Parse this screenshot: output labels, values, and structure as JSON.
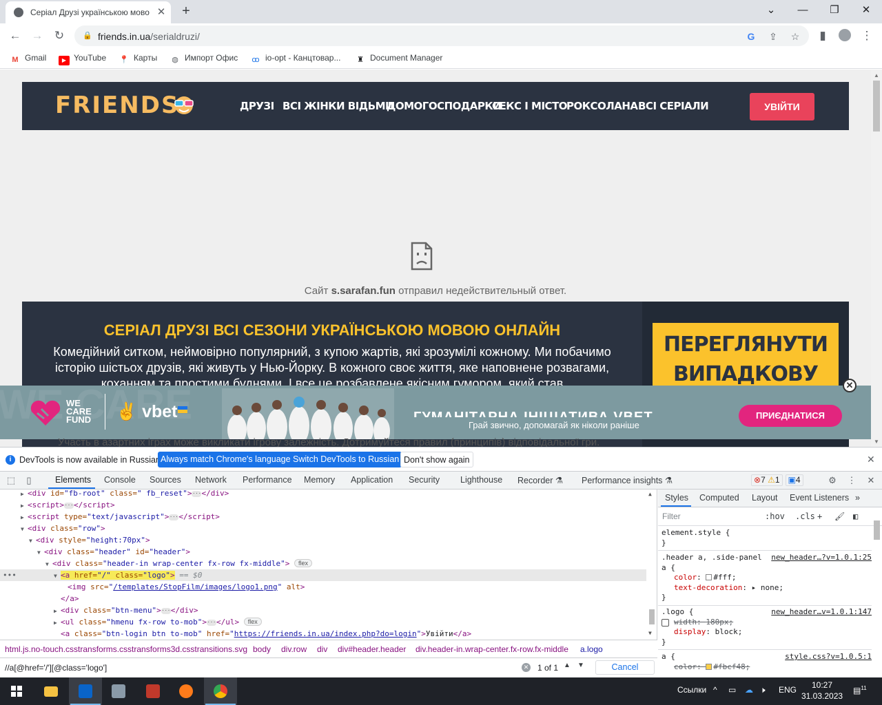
{
  "browser": {
    "tab_title": "Серіал Друзі українською мово",
    "url_host": "friends.in.ua",
    "url_path": "/serialdruzi/",
    "bookmarks": [
      "Gmail",
      "YouTube",
      "Карты",
      "Импорт Офис",
      "io-opt - Канцтовар...",
      "Document Manager"
    ]
  },
  "site": {
    "logo_text": "FRIENDS",
    "nav": [
      "ДРУЗІ",
      "ВСІ ЖІНКИ ВІДЬМИ",
      "ДОМОГОСПОДАРКИ",
      "СЕКС І МІСТО",
      "РОКСОЛАНА",
      "ВСІ СЕРІАЛИ"
    ],
    "login": "УВІЙТИ",
    "error_host": "s.sarafan.fun",
    "error_prefix": "Сайт",
    "error_suffix": "отправил недействительный ответ.",
    "hero_title": "СЕРІАЛ ДРУЗІ ВСІ СЕЗОНИ УКРАЇНСЬКОЮ МОВОЮ ОНЛАЙН",
    "hero_text": "Комедійний ситком, неймовірно популярний, з купою жартів, які зрозумілі кожному. Ми побачимо історію шістьох друзів, які живуть у Нью-Йорку. В кожного своє життя, яке наповнене розвагами, коханням та простими буднями. І все це розбавлене якісним гумором, який став",
    "random_line1": "ПЕРЕГЛЯНУТИ",
    "random_line2": "ВИПАДКОВУ СЕРІЮ",
    "disclaimer": "Участь в азартних іграх може викликати ігрову залежність. Дотримуйтеся правил (принципів) відповідальної гри."
  },
  "ad": {
    "watermark": "WE CARE",
    "wecare": [
      "WE",
      "CARE",
      "FUND"
    ],
    "vbet": "vbet",
    "headline": "ГУМАНІТАРНА ІНІЦІАТИВА VBET",
    "tagline": "Грай звично, допомагай як ніколи раніше",
    "join": "ПРИЄДНАТИСЯ"
  },
  "devtools": {
    "infobar_text": "DevTools is now available in Russian!",
    "infobar_btn1": "Always match Chrome's language",
    "infobar_btn2": "Switch DevTools to Russian",
    "infobar_btn3": "Don't show again",
    "tabs": [
      "Elements",
      "Console",
      "Sources",
      "Network",
      "Performance",
      "Memory",
      "Application",
      "Security",
      "Lighthouse",
      "Recorder",
      "Performance insights"
    ],
    "errors": "7",
    "warnings": "1",
    "messages": "4",
    "dom": {
      "l1_attr_id": "id=",
      "l1_id": "\"fb-root\"",
      "l1_class": "class=",
      "l1_classv": "\" fb_reset\"",
      "l5": "\"row\"",
      "l6_style": "\"height:70px\"",
      "l7_class": "\"header\"",
      "l7_id": "\"header\"",
      "l8_class": "\"header-in wrap-center fx-row fx-middle\"",
      "l9_href": "\"/\"",
      "l9_class": "\"logo\"",
      "l9_eq": "== $0",
      "l10_src": "/templates/StopFilm/images/logo1.png",
      "l12_class": "\"btn-menu\"",
      "l13_class": "\"hmenu fx-row to-mob\"",
      "l14_class": "\"btn-login btn to-mob\"",
      "l14_href": "https://friends.in.ua/index.php?do=login",
      "l14_text": "Увійти",
      "flex": "flex",
      "script_type": "\"text/javascript\""
    },
    "breadcrumbs": [
      "html.js.no-touch.csstransforms.csstransforms3d.csstransitions.svg",
      "body",
      "div.row",
      "div",
      "div#header.header",
      "div.header-in.wrap-center.fx-row.fx-middle",
      "a.logo"
    ],
    "search_value": "//a[@href='/'][@class='logo']",
    "search_count": "1 of 1",
    "search_cancel": "Cancel",
    "styles_tabs": [
      "Styles",
      "Computed",
      "Layout",
      "Event Listeners"
    ],
    "filter_placeholder": "Filter",
    "hov": ":hov",
    "cls": ".cls",
    "rules": {
      "r1_sel": "element.style {",
      "r2_sel": ".header a, .side-panel a {",
      "r2_src": "new_header…?v=1.0.1:25",
      "r2_p1": "color",
      "r2_v1": "#fff;",
      "r2_p2": "text-decoration",
      "r2_v2": "none;",
      "r3_sel": ".logo {",
      "r3_src": "new_header…v=1.0.1:147",
      "r3_p1": "width",
      "r3_v1": "180px;",
      "r3_p2": "display",
      "r3_v2": "block;",
      "r4_sel": "a {",
      "r4_src": "style.css?v=1.0.5:1",
      "r4_p1": "color",
      "r4_v1": "#fbcf48;",
      "close": "}"
    }
  },
  "taskbar": {
    "lang_link": "Ссылки",
    "lang": "ENG",
    "time": "10:27",
    "date": "31.03.2023",
    "notif_count": "11"
  },
  "colors": {
    "header_bg": "#2b3341",
    "accent_red": "#e9435b",
    "accent_yellow": "#fbc22c",
    "devtools_blue": "#1a73e8"
  }
}
